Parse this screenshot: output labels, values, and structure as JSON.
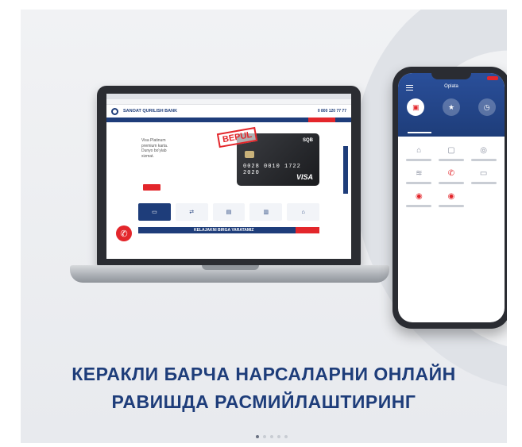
{
  "headline": {
    "line1": "КЕРАКЛИ БАРЧА НАРСАЛАРНИ ОНЛАЙН",
    "line2": "РАВИШДА РАСМИЙЛАШТИРИНГ"
  },
  "carousel": {
    "count": 5,
    "active_index": 0
  },
  "laptop_site": {
    "bank_name": "SANOAT QURILISH BANK",
    "phone": "0 800 120 77 77",
    "hero_text": "Visa Platinum premium karta. Dunyo bo'ylab xizmat.",
    "stamp": "BEPUL",
    "card_logo": "SQB",
    "card_number": "0028 0010 1722 2020",
    "card_brand": "VISA",
    "banner": "KELAJAKNI BIRGA YARATAMIZ",
    "service_icons": [
      "card-icon",
      "exchange-icon",
      "deposit-icon",
      "transfer-icon",
      "bank-icon"
    ]
  },
  "phone_app": {
    "title": "Oplata",
    "tabs": [
      {
        "icon": "wallet-icon"
      },
      {
        "icon": "star-icon"
      },
      {
        "icon": "clock-icon"
      }
    ],
    "grid_icons": [
      "bank-icon",
      "wallet-icon",
      "utility-icon",
      "wifi-icon",
      "phone-icon",
      "tv-icon",
      "other-icon",
      "gov-icon"
    ]
  },
  "colors": {
    "brand_blue": "#1e3d7a",
    "accent_red": "#e3262b"
  }
}
